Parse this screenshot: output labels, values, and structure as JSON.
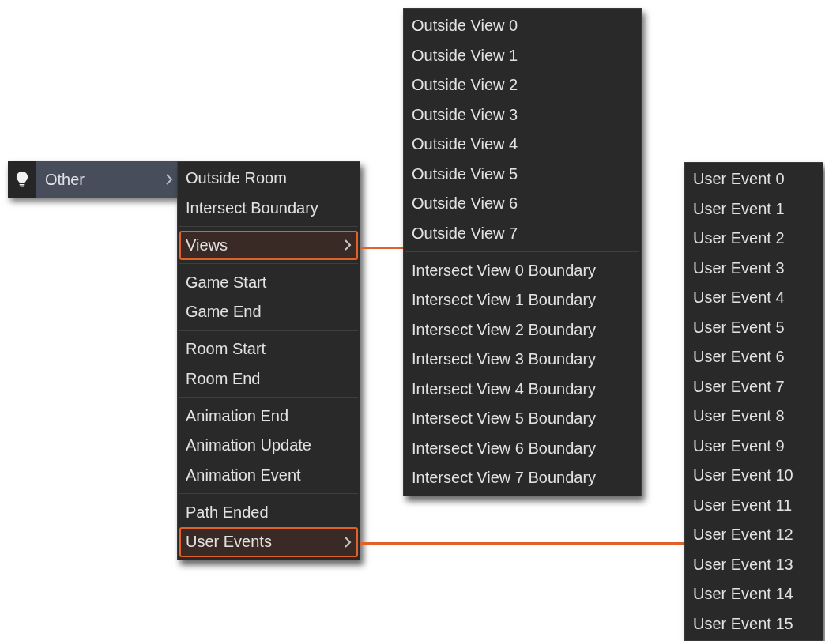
{
  "category_button": {
    "label": "Other"
  },
  "menu": {
    "groups": [
      {
        "items": [
          {
            "label": "Outside Room",
            "kind": "item",
            "selected": false
          },
          {
            "label": "Intersect Boundary",
            "kind": "item",
            "selected": false
          }
        ]
      },
      {
        "items": [
          {
            "label": "Views",
            "kind": "submenu",
            "selected": true
          }
        ]
      },
      {
        "items": [
          {
            "label": "Game Start",
            "kind": "item",
            "selected": false
          },
          {
            "label": "Game End",
            "kind": "item",
            "selected": false
          }
        ]
      },
      {
        "items": [
          {
            "label": "Room Start",
            "kind": "item",
            "selected": false
          },
          {
            "label": "Room End",
            "kind": "item",
            "selected": false
          }
        ]
      },
      {
        "items": [
          {
            "label": "Animation End",
            "kind": "item",
            "selected": false
          },
          {
            "label": "Animation Update",
            "kind": "item",
            "selected": false
          },
          {
            "label": "Animation Event",
            "kind": "item",
            "selected": false
          }
        ]
      },
      {
        "items": [
          {
            "label": "Path Ended",
            "kind": "item",
            "selected": false
          },
          {
            "label": "User Events",
            "kind": "submenu",
            "selected": true
          }
        ]
      }
    ]
  },
  "views_submenu": {
    "groups": [
      {
        "items": [
          "Outside View 0",
          "Outside View 1",
          "Outside View 2",
          "Outside View 3",
          "Outside View 4",
          "Outside View 5",
          "Outside View 6",
          "Outside View 7"
        ]
      },
      {
        "items": [
          "Intersect View 0 Boundary",
          "Intersect View 1 Boundary",
          "Intersect View 2 Boundary",
          "Intersect View 3 Boundary",
          "Intersect View 4 Boundary",
          "Intersect View 5 Boundary",
          "Intersect View 6 Boundary",
          "Intersect View 7 Boundary"
        ]
      }
    ]
  },
  "user_events_submenu": {
    "items": [
      "User Event 0",
      "User Event 1",
      "User Event 2",
      "User Event 3",
      "User Event 4",
      "User Event 5",
      "User Event 6",
      "User Event 7",
      "User Event 8",
      "User Event 9",
      "User Event 10",
      "User Event 11",
      "User Event 12",
      "User Event 13",
      "User Event 14",
      "User Event 15"
    ]
  }
}
